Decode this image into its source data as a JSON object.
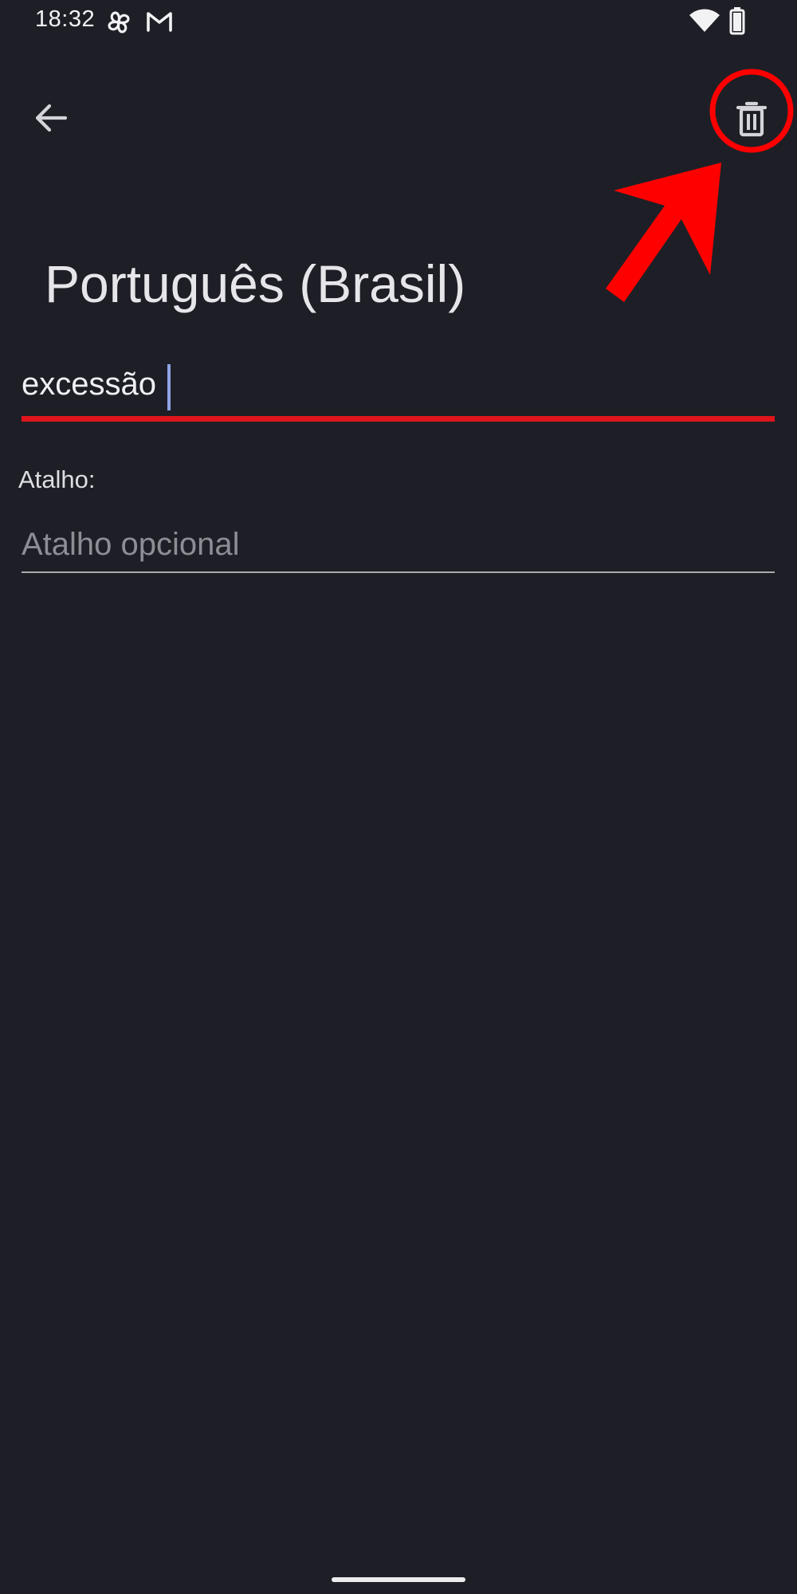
{
  "status_bar": {
    "time": "18:32",
    "icons": [
      "pinwheel-icon",
      "gmail-icon",
      "wifi-icon",
      "battery-icon"
    ]
  },
  "app_bar": {
    "back_icon": "arrow-back-icon",
    "delete_icon": "trash-icon"
  },
  "page": {
    "title": "Português (Brasil)"
  },
  "word_field": {
    "value": "excessão"
  },
  "shortcut_field": {
    "label": "Atalho:",
    "placeholder": "Atalho opcional"
  },
  "annotation": {
    "color": "#ff0000",
    "target": "delete-button"
  },
  "colors": {
    "background": "#1e1f26",
    "cursor": "#8ea4e6",
    "underline_active": "#e0151b"
  }
}
